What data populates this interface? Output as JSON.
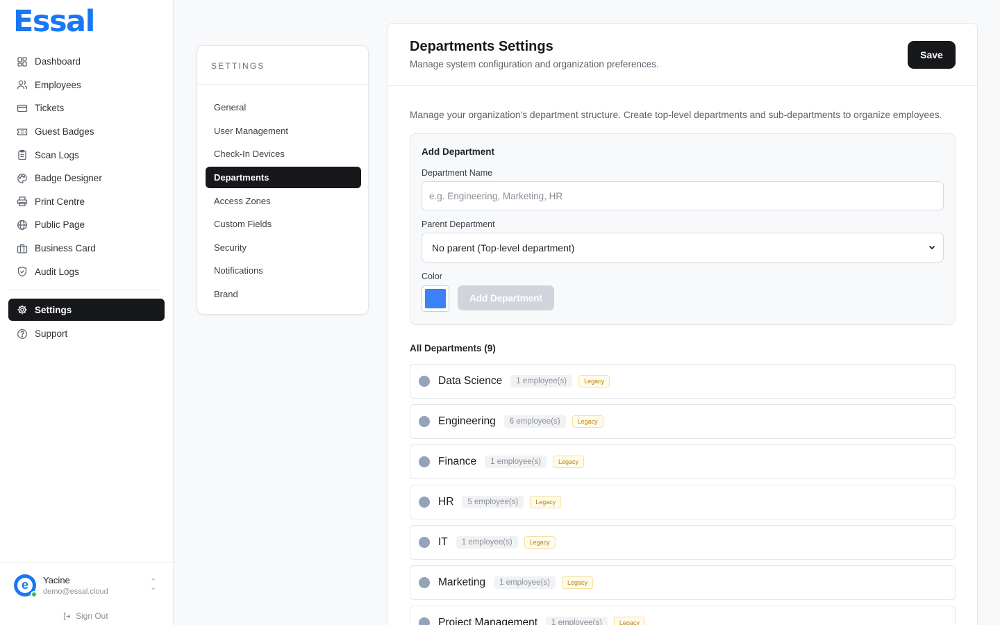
{
  "app": {
    "logo": "Essal"
  },
  "sidebar": {
    "items": [
      {
        "label": "Dashboard",
        "icon": "dashboard-icon"
      },
      {
        "label": "Employees",
        "icon": "users-icon"
      },
      {
        "label": "Tickets",
        "icon": "ticket-icon"
      },
      {
        "label": "Guest Badges",
        "icon": "badge-icon"
      },
      {
        "label": "Scan Logs",
        "icon": "clipboard-icon"
      },
      {
        "label": "Badge Designer",
        "icon": "palette-icon"
      },
      {
        "label": "Print Centre",
        "icon": "printer-icon"
      },
      {
        "label": "Public Page",
        "icon": "globe-icon"
      },
      {
        "label": "Business Card",
        "icon": "briefcase-icon"
      },
      {
        "label": "Audit Logs",
        "icon": "shield-icon"
      }
    ],
    "bottom_items": [
      {
        "label": "Settings",
        "icon": "gear-icon",
        "active": true
      },
      {
        "label": "Support",
        "icon": "help-icon"
      }
    ],
    "user": {
      "name": "Yacine",
      "email": "demo@essal.cloud",
      "initial": "e"
    },
    "signout_label": "Sign Out"
  },
  "settings_nav": {
    "title": "SETTINGS",
    "items": [
      {
        "label": "General"
      },
      {
        "label": "User Management"
      },
      {
        "label": "Check-In Devices"
      },
      {
        "label": "Departments",
        "active": true
      },
      {
        "label": "Access Zones"
      },
      {
        "label": "Custom Fields"
      },
      {
        "label": "Security"
      },
      {
        "label": "Notifications"
      },
      {
        "label": "Brand"
      }
    ]
  },
  "main": {
    "title": "Departments Settings",
    "subtitle": "Manage system configuration and organization preferences.",
    "save_label": "Save",
    "description": "Manage your organization's department structure. Create top-level departments and sub-departments to organize employees.",
    "add_form": {
      "title": "Add Department",
      "name_label": "Department Name",
      "name_placeholder": "e.g. Engineering, Marketing, HR",
      "parent_label": "Parent Department",
      "parent_value": "No parent (Top-level department)",
      "color_label": "Color",
      "color_value": "#3b82f6",
      "add_label": "Add Department"
    },
    "list_title": "All Departments (9)",
    "departments": [
      {
        "name": "Data Science",
        "count": "1 employee(s)",
        "badge": "Legacy"
      },
      {
        "name": "Engineering",
        "count": "6 employee(s)",
        "badge": "Legacy"
      },
      {
        "name": "Finance",
        "count": "1 employee(s)",
        "badge": "Legacy"
      },
      {
        "name": "HR",
        "count": "5 employee(s)",
        "badge": "Legacy"
      },
      {
        "name": "IT",
        "count": "1 employee(s)",
        "badge": "Legacy"
      },
      {
        "name": "Marketing",
        "count": "1 employee(s)",
        "badge": "Legacy"
      },
      {
        "name": "Project Management",
        "count": "1 employee(s)",
        "badge": "Legacy"
      }
    ]
  }
}
